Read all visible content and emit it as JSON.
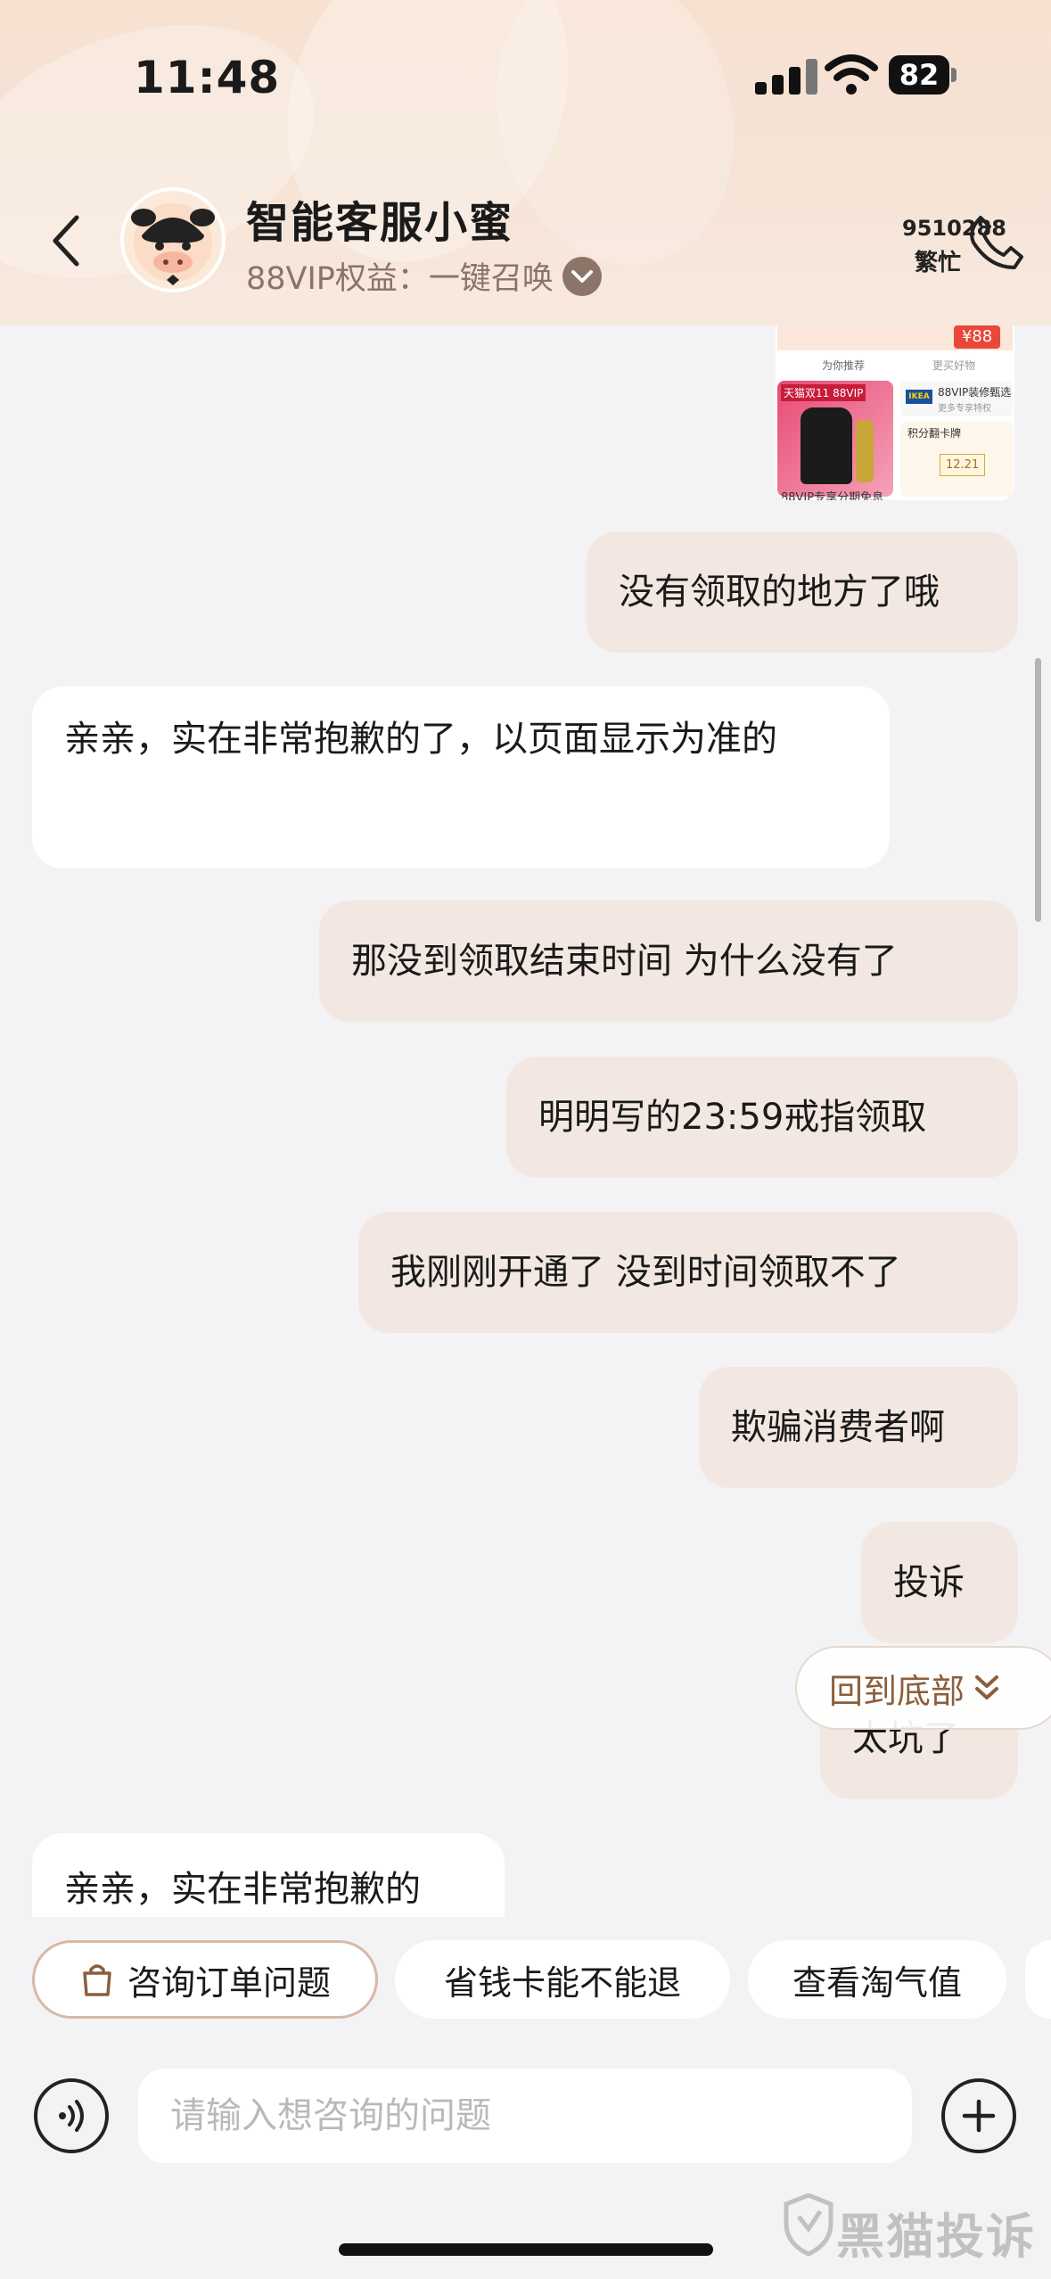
{
  "status_bar": {
    "time": "11:48",
    "battery": "82"
  },
  "header": {
    "title": "智能客服小蜜",
    "subtitle": "88VIP权益：一键召唤",
    "phone_number": "9510288",
    "phone_status": "繁忙"
  },
  "product_card": {
    "price": "¥88",
    "tab_left": "为你推荐",
    "tab_right": "更买好物",
    "tag": "天猫双11 88VIP",
    "right_top": "88VIP装修甄选",
    "right_top_sub": "更多专享特权",
    "right_bottom": "积分翻卡牌",
    "right_bottom_date": "12.21",
    "caption": "88VIP专享分期免息"
  },
  "messages": [
    {
      "role": "user",
      "text": "没有领取的地方了哦"
    },
    {
      "role": "bot",
      "text": "亲亲，实在非常抱歉的了，以页面显示为准的"
    },
    {
      "role": "user",
      "text": "那没到领取结束时间 为什么没有了"
    },
    {
      "role": "user",
      "text": "明明写的23:59戒指领取"
    },
    {
      "role": "user",
      "text": "我刚刚开通了 没到时间领取不了"
    },
    {
      "role": "user",
      "text": "欺骗消费者啊"
    },
    {
      "role": "user",
      "text": "投诉"
    },
    {
      "role": "user",
      "text": "太坑了"
    },
    {
      "role": "bot",
      "text": "亲亲，实在非常抱歉的"
    }
  ],
  "back_to_bottom": "回到底部",
  "quick_replies": [
    "咨询订单问题",
    "省钱卡能不能退",
    "查看淘气值"
  ],
  "input": {
    "placeholder": "请输入想咨询的问题"
  },
  "watermark": "黑猫投诉",
  "colors": {
    "user_bubble": "#f3e8e1",
    "bot_bubble": "#ffffff",
    "accent_brown": "#8b5e3c",
    "header_bg": "#f7e2d2"
  }
}
